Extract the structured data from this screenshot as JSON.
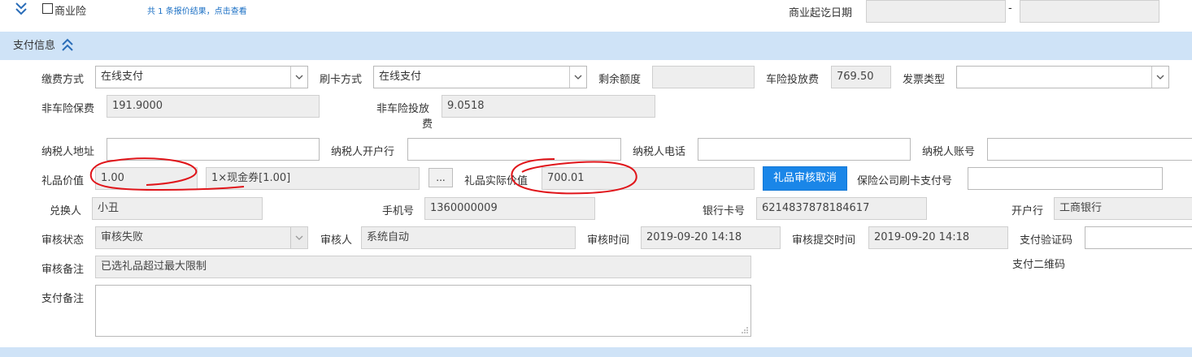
{
  "top": {
    "commercial_label": "商业险",
    "quote_link": "共 1 条报价结果，点击查看",
    "start_date_label": "商业起讫日期",
    "date_sep": "-",
    "date_from": "",
    "date_to": ""
  },
  "section": {
    "title": "支付信息"
  },
  "fields": {
    "payment_method_label": "缴费方式",
    "payment_method_value": "在线支付",
    "card_method_label": "刷卡方式",
    "card_method_value": "在线支付",
    "remaining_label": "剩余额度",
    "remaining_value": "",
    "auto_fee_label": "车险投放费",
    "auto_fee_value": "769.50",
    "invoice_type_label": "发票类型",
    "invoice_type_value": "",
    "nonauto_premium_label": "非车险保费",
    "nonauto_premium_value": "191.9000",
    "nonauto_fee_label_1": "非车险投放",
    "nonauto_fee_label_2": "费",
    "nonauto_fee_value": "9.0518",
    "taxpayer_address_label": "纳税人地址",
    "taxpayer_bank_label": "纳税人开户行",
    "taxpayer_phone_label": "纳税人电话",
    "taxpayer_account_label": "纳税人账号",
    "gift_value_label": "礼品价值",
    "gift_value": "1.00",
    "gift_detail": "1×现金券[1.00]",
    "dots_label": "...",
    "gift_actual_label": "礼品实际价值",
    "gift_actual_value": "700.01",
    "gift_cancel_button": "礼品审核取消",
    "insurer_card_label": "保险公司刷卡支付号",
    "redeemer_label": "兑换人",
    "redeemer_value": "小丑",
    "mobile_label": "手机号",
    "mobile_value": "1360000009",
    "bank_card_label": "银行卡号",
    "bank_card_value": "6214837878184617",
    "bank_label": "开户行",
    "bank_value": "工商银行",
    "audit_status_label": "审核状态",
    "audit_status_value": "审核失败",
    "auditor_label": "审核人",
    "auditor_value": "系统自动",
    "audit_time_label": "审核时间",
    "audit_time_value": "2019-09-20 14:18",
    "audit_submit_label": "审核提交时间",
    "audit_submit_value": "2019-09-20 14:18",
    "pay_code_label": "支付验证码",
    "audit_remark_label": "审核备注",
    "audit_remark_value": "已选礼品超过最大限制",
    "pay_qr_label": "支付二维码",
    "pay_remark_label": "支付备注"
  },
  "colors": {
    "section_band": "#cfe3f7",
    "button_blue": "#1a86e8",
    "annotation_red": "#e0151a"
  }
}
